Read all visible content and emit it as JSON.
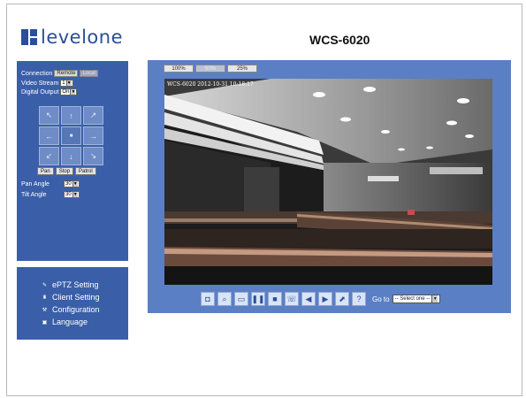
{
  "header": {
    "logo_text": "levelone",
    "model": "WCS-6020"
  },
  "controls": {
    "connection_label": "Connection",
    "connection_remote": "Remote",
    "connection_local": "Local",
    "video_stream_label": "Video Stream",
    "video_stream_value": "1",
    "digital_output_label": "Digital Output",
    "digital_output_value": "On",
    "ptz_buttons": [
      "Pan",
      "Stop",
      "Patrol"
    ],
    "pan_angle_label": "Pan Angle",
    "pan_angle_value": "30",
    "tilt_angle_label": "Tilt Angle",
    "tilt_angle_value": "30"
  },
  "menu": {
    "eptz": "ePTZ Setting",
    "client": "Client Setting",
    "config": "Configuration",
    "language": "Language"
  },
  "video": {
    "zoom_100": "100%",
    "zoom_50": "50%",
    "zoom_25": "25%",
    "osd_text": "WCS-6020 2012-10-31 10:18:17",
    "goto_label": "Go to",
    "goto_value": "-- Select one --"
  },
  "icons": {
    "snapshot": "camera-icon",
    "zoom": "magnifier-icon",
    "fullscreen": "fullscreen-icon",
    "pause": "pause-icon",
    "stop": "stop-icon",
    "talk": "talk-icon",
    "volume": "speaker-icon",
    "record": "record-icon",
    "output": "output-icon",
    "help": "help-icon"
  }
}
